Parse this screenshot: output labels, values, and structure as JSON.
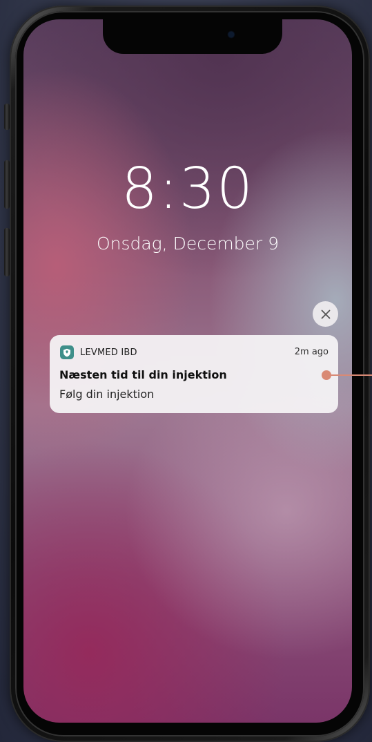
{
  "lockscreen": {
    "time": "8:30",
    "date": "Onsdag, December 9"
  },
  "notification": {
    "app_name": "LEVMED IBD",
    "time_ago": "2m ago",
    "title": "Næsten tid til din injektion",
    "body": "Følg din injektion"
  },
  "icons": {
    "close": "close-icon",
    "app": "shield-icon"
  },
  "colors": {
    "app_icon": "#3f8f8a",
    "callout": "#d98a75",
    "notification_bg": "#f4f2f4"
  }
}
